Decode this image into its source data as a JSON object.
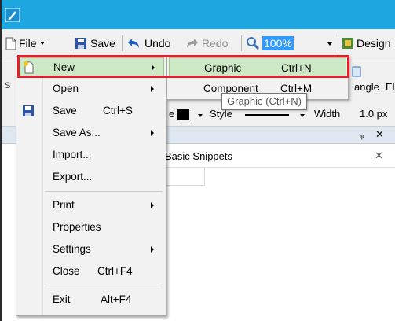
{
  "toolbar": {
    "file_label": "File",
    "save_label": "Save",
    "undo_label": "Undo",
    "redo_label": "Redo",
    "zoom_value": "100%",
    "design_label": "Design"
  },
  "background": {
    "angle_label": "angle",
    "el_label": "El",
    "style_label": "Style",
    "width_label": "Width",
    "width_value": "1.0 px",
    "e_label": "e",
    "panel_title": "Basic Snippets",
    "pin_glyph": "ᵩ",
    "close_glyph": "✕"
  },
  "file_menu": {
    "items": [
      {
        "label": "New",
        "shortcut": "",
        "has_submenu": true,
        "icon": "new-doc-icon"
      },
      {
        "label": "Open",
        "shortcut": "",
        "has_submenu": true
      },
      {
        "label": "Save",
        "shortcut": "Ctrl+S",
        "has_submenu": false,
        "icon": "floppy-icon"
      },
      {
        "label": "Save As...",
        "shortcut": "",
        "has_submenu": true
      },
      {
        "label": "Import...",
        "shortcut": "",
        "has_submenu": false
      },
      {
        "label": "Export...",
        "shortcut": "",
        "has_submenu": false
      },
      {
        "label": "Print",
        "shortcut": "",
        "has_submenu": true
      },
      {
        "label": "Properties",
        "shortcut": "",
        "has_submenu": false
      },
      {
        "label": "Settings",
        "shortcut": "",
        "has_submenu": true
      },
      {
        "label": "Close",
        "shortcut": "Ctrl+F4",
        "has_submenu": false
      },
      {
        "label": "Exit",
        "shortcut": "Alt+F4",
        "has_submenu": false
      }
    ]
  },
  "new_submenu": {
    "items": [
      {
        "label": "Graphic",
        "shortcut": "Ctrl+N"
      },
      {
        "label": "Component",
        "shortcut": "Ctrl+M"
      }
    ]
  },
  "tooltip": "Graphic (Ctrl+N)",
  "colors": {
    "titlebar": "#1da6df",
    "hover_bg": "#cde8c4",
    "highlight": "#e0202a",
    "zoom_selection": "#3399ff"
  }
}
